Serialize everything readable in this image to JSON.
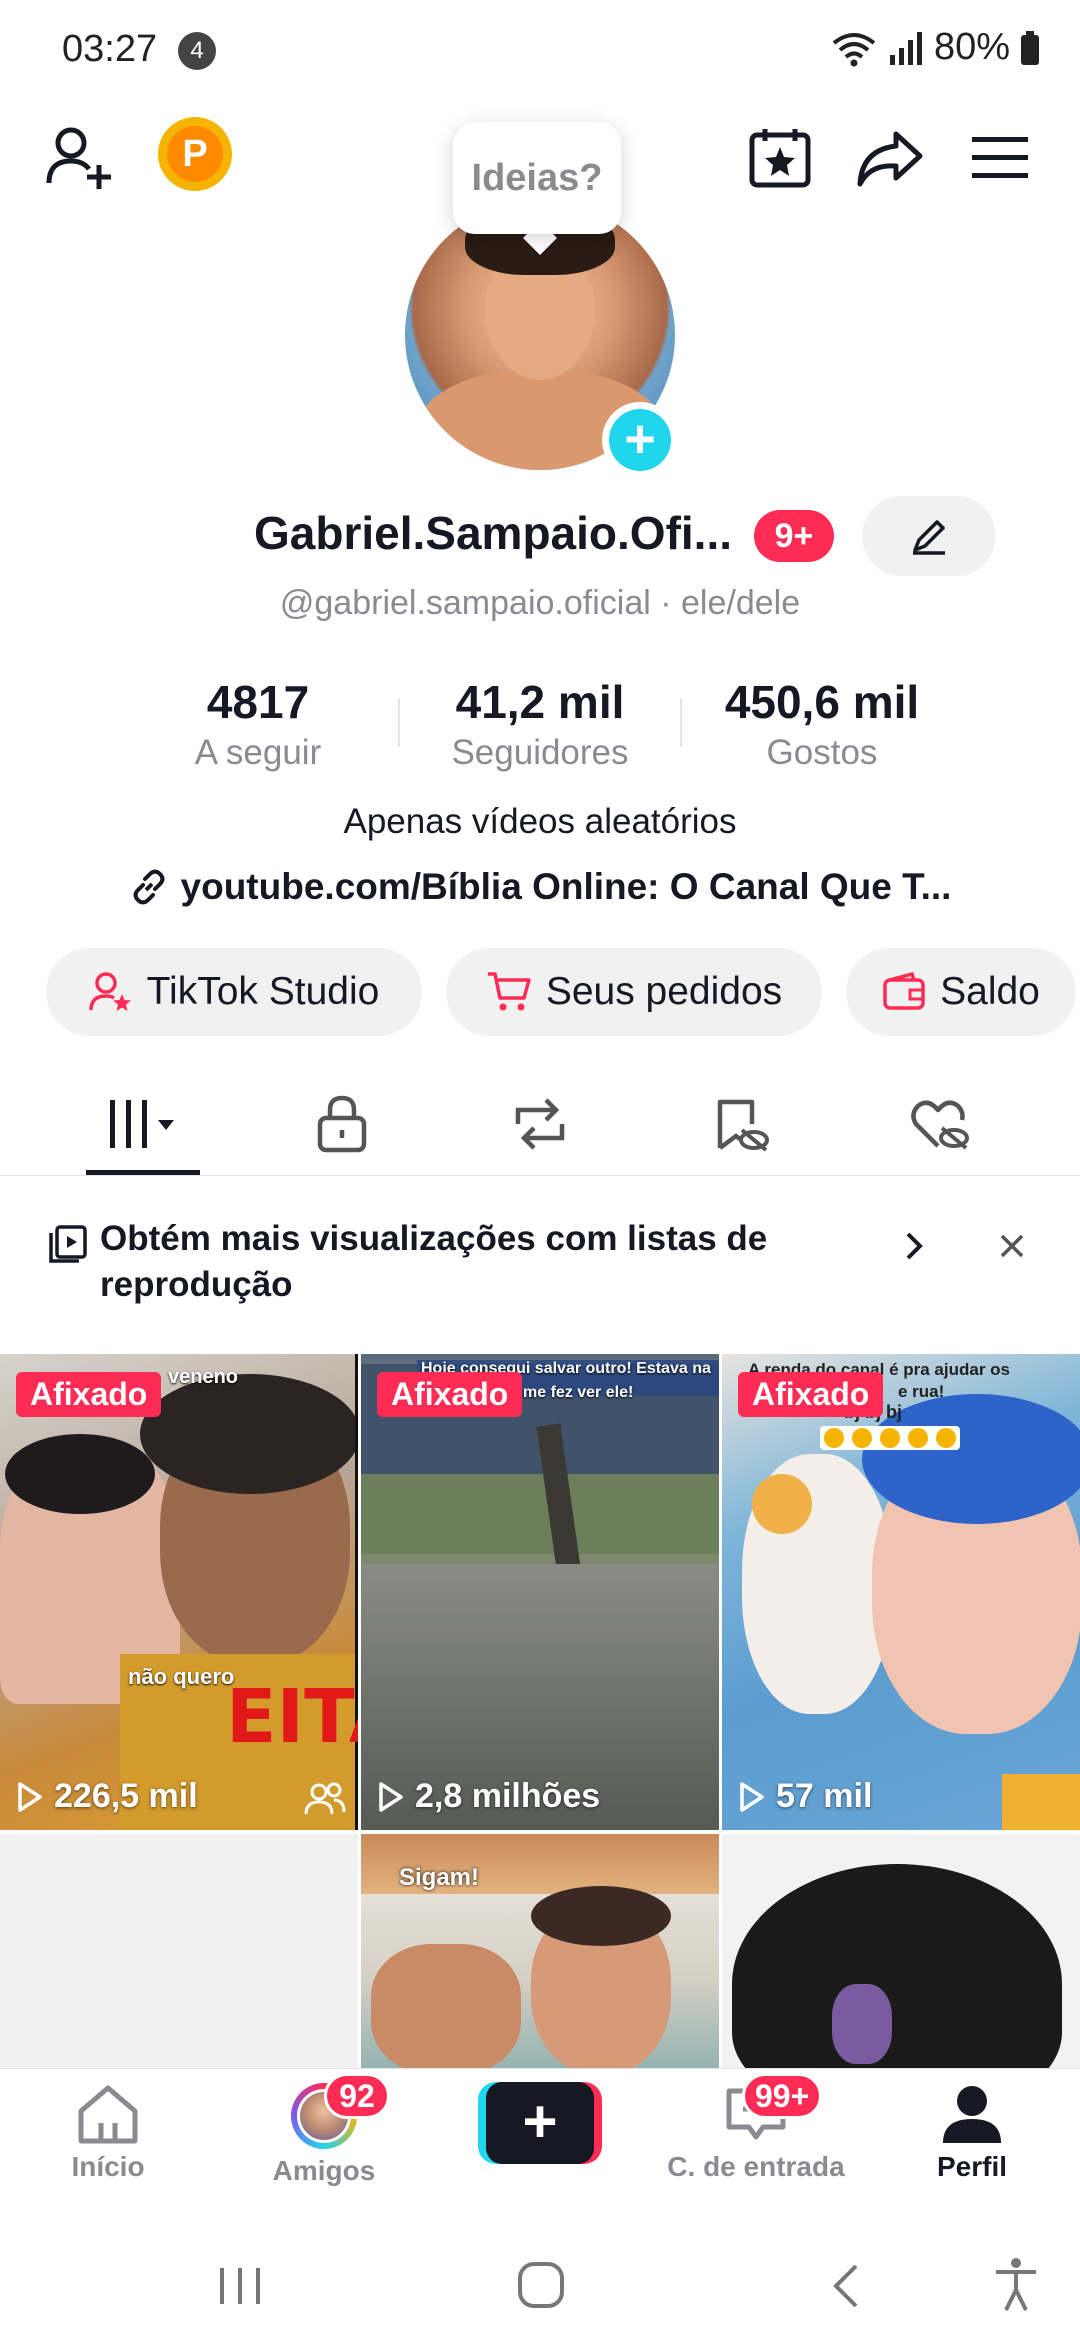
{
  "status_bar": {
    "time": "03:27",
    "notification_count": "4",
    "battery": "80%"
  },
  "profile": {
    "ideas_tooltip": "Ideias?",
    "name": "Gabriel.Sampaio.Ofi...",
    "name_badge": "9+",
    "handle": "@gabriel.sampaio.oficial · ele/dele",
    "bio": "Apenas vídeos aleatórios",
    "link": "youtube.com/Bíblia Online: O Canal Que T..."
  },
  "stats": [
    {
      "value": "4817",
      "label": "A seguir"
    },
    {
      "value": "41,2 mil",
      "label": "Seguidores"
    },
    {
      "value": "450,6 mil",
      "label": "Gostos"
    }
  ],
  "actions": {
    "studio": "TikTok Studio",
    "orders": "Seus pedidos",
    "balance": "Saldo"
  },
  "banner": {
    "text": "Obtém mais visualizações com listas de reprodução"
  },
  "videos": [
    {
      "pinned": "Afixado",
      "views": "226,5 mil",
      "caption_top": "veneno",
      "caption_mid": "não quero",
      "caption_big": "EITA!"
    },
    {
      "pinned": "Afixado",
      "views": "2,8 milhões",
      "caption_top": "Hoje consegui salvar outro! Estava na chuva,",
      "caption_top2": "eus me fez ver ele!"
    },
    {
      "pinned": "Afixado",
      "views": "57 mil",
      "caption_top": "A renda do canal é pra ajudar os",
      "caption_top2": "e rua!",
      "caption_top3": "bj bj bj"
    },
    {
      "caption_top": "Sigam!"
    }
  ],
  "bottom_nav": {
    "home": "Início",
    "friends": "Amigos",
    "friends_badge": "92",
    "inbox": "C. de entrada",
    "inbox_badge": "99+",
    "profile": "Perfil"
  },
  "colors": {
    "accent_red": "#fe2c55",
    "accent_cyan": "#20d5ec",
    "text_primary": "#161823",
    "text_secondary": "#8a8b91"
  }
}
